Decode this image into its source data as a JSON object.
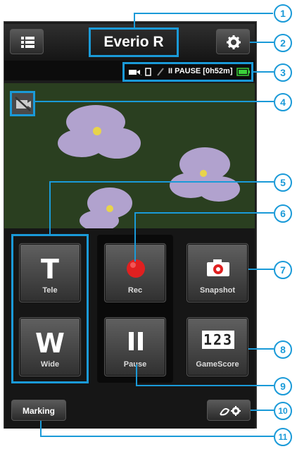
{
  "header": {
    "menu_icon": "list-icon",
    "title": "Everio R",
    "settings_icon": "gear-icon"
  },
  "status": {
    "text": "II PAUSE [0h52m]",
    "icons": [
      "camcorder-icon",
      "signal-icon",
      "wifi-off-icon",
      "battery-icon"
    ]
  },
  "preview": {
    "toggle_icon": "monitor-off-icon"
  },
  "buttons": {
    "tele": {
      "letter": "T",
      "label": "Tele"
    },
    "wide": {
      "letter": "W",
      "label": "Wide"
    },
    "rec": {
      "label": "Rec",
      "icon": "record-icon"
    },
    "pause": {
      "label": "Pause",
      "icon": "pause-icon"
    },
    "snapshot": {
      "label": "Snapshot",
      "icon": "camera-icon"
    },
    "gamescore": {
      "label": "GameScore",
      "icon_text": "123"
    },
    "marking": {
      "label": "Marking"
    },
    "settings2_icon": "gear-icon"
  },
  "callouts": [
    "1",
    "2",
    "3",
    "4",
    "5",
    "6",
    "7",
    "8",
    "9",
    "10",
    "11"
  ],
  "colors": {
    "accent": "#1a9ad8",
    "rec_red": "#e02020",
    "battery_green": "#3bd13b"
  }
}
